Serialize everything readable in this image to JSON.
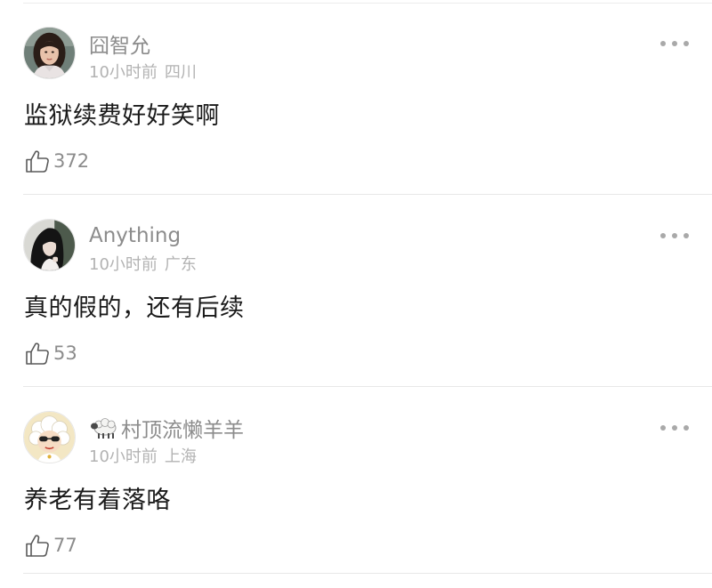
{
  "comments": [
    {
      "username": "囧智允",
      "time": "10小时前",
      "location": "四川",
      "text": "监狱续费好好笑啊",
      "likes": "372",
      "avatar_icon": "woman-portrait-avatar"
    },
    {
      "username": "Anything",
      "time": "10小时前",
      "location": "广东",
      "text": "真的假的，还有后续",
      "likes": "53",
      "avatar_icon": "dark-hair-portrait-avatar"
    },
    {
      "username": "村顶流懒羊羊",
      "username_emoji": "sheep-emoji",
      "time": "10小时前",
      "location": "上海",
      "text": "养老有着落咯",
      "likes": "77",
      "avatar_icon": "cartoon-sheep-avatar"
    }
  ],
  "colors": {
    "username": "#8c8c8c",
    "meta": "#b3b3b3",
    "text": "#1a1a1a",
    "divider": "#e8e8e8"
  }
}
